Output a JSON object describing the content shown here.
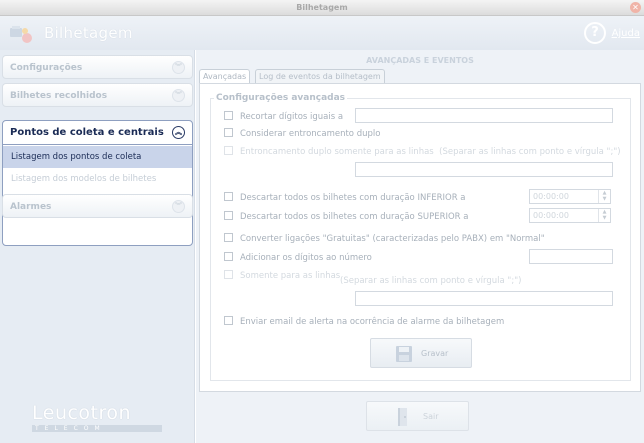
{
  "window": {
    "title": "Bilhetagem",
    "close_glyph": "✕"
  },
  "header": {
    "app_title": "Bilhetagem",
    "help_label": "Ajuda",
    "help_glyph": "?"
  },
  "sidebar": {
    "sections": [
      {
        "label": "Configurações"
      },
      {
        "label": "Bilhetes recolhidos"
      }
    ],
    "active_section": {
      "label": "Pontos de coleta e centrais",
      "items": [
        {
          "label": "Listagem dos pontos de coleta",
          "selected": true
        },
        {
          "label": "Listagem dos modelos de bilhetes",
          "selected": false
        }
      ]
    },
    "bottom_section": {
      "label": "Alarmes"
    },
    "brand": {
      "name": "Leucotron",
      "subtitle": "TELECOM"
    }
  },
  "main": {
    "title": "AVANÇADAS E EVENTOS",
    "tabs": [
      {
        "label": "Avançadas",
        "active": true
      },
      {
        "label": "Log de eventos da bilhetagem",
        "active": false
      }
    ],
    "group_title": "Configurações avançadas",
    "options": {
      "recortar": "Recortar dígitos iguais a",
      "considerar": "Considerar entroncamento duplo",
      "entroncamento": "Entroncamento duplo somente para as linhas",
      "entroncamento_hint": "(Separar as linhas com ponto e vírgula \";\")",
      "descartar_inferior": "Descartar todos os bilhetes com duração INFERIOR a",
      "descartar_superior": "Descartar todos os bilhetes com duração SUPERIOR a",
      "converter": "Converter ligações \"Gratuitas\" (caracterizadas pelo PABX) em \"Normal\"",
      "adicionar": "Adicionar os dígitos ao número",
      "somente": "Somente para as linhas",
      "somente_hint": "(Separar as linhas com ponto e vírgula \";\")",
      "enviar": "Enviar email de alerta na ocorrência de alarme da bilhetagem"
    },
    "duration_inferior": "00:00:00",
    "duration_superior": "00:00:00",
    "save_label": "Gravar",
    "exit_label": "Sair"
  },
  "colors": {
    "accent": "#1a2b55",
    "selection": "#c9d4ea",
    "border_active": "#8e9fc0"
  }
}
